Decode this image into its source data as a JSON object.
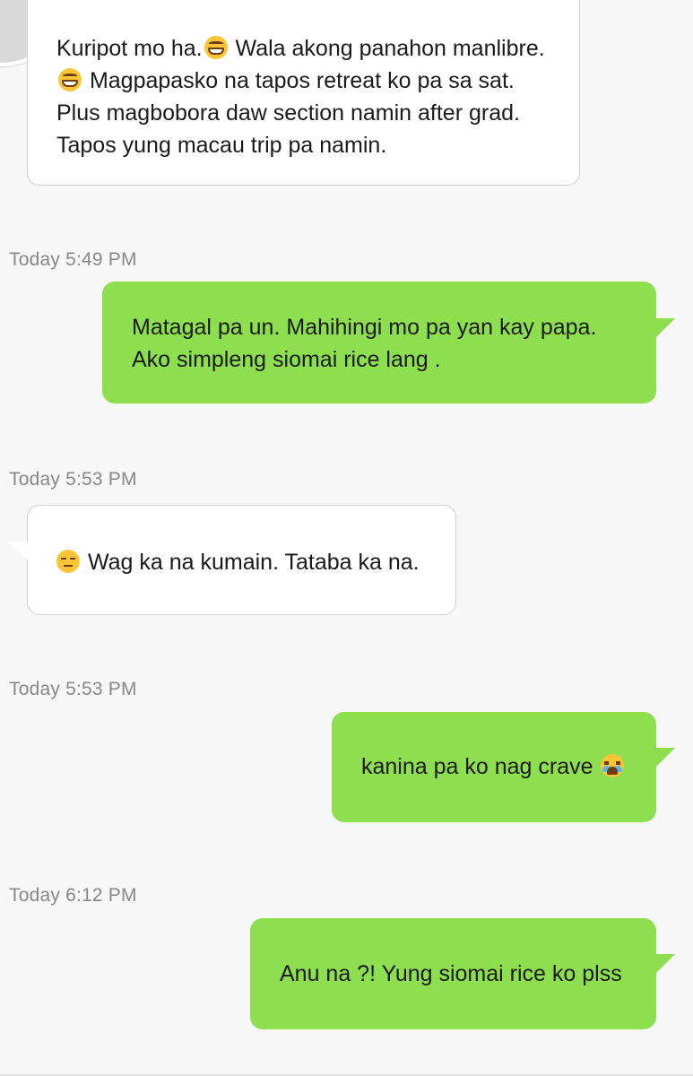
{
  "conversation": {
    "messages": [
      {
        "direction": "incoming",
        "segments": [
          "Kuripot mo ha.",
          " Wala akong panahon manlibre.",
          " Magpapasko na tapos retreat ko pa sa sat. Plus magbobora daw section namin after grad. Tapos yung macau trip pa namin."
        ],
        "emojis": [
          "grinning-face-emoji",
          "grinning-face-emoji"
        ]
      },
      {
        "direction": "outgoing",
        "timestamp": "Today 5:49 PM",
        "text": "Matagal pa un. Mahihingi mo pa yan kay papa. Ako simpleng siomai rice lang ."
      },
      {
        "direction": "incoming",
        "timestamp": "Today 5:53 PM",
        "text": "Wag ka na kumain. Tataba ka na.",
        "emoji": "expressionless-face-emoji"
      },
      {
        "direction": "outgoing",
        "timestamp": "Today 5:53 PM",
        "text": "kanina pa ko nag crave",
        "emoji": "crying-face-emoji"
      },
      {
        "direction": "outgoing",
        "timestamp": "Today 6:12 PM",
        "text": "Anu na ?! Yung siomai rice ko plss"
      }
    ]
  },
  "colors": {
    "background": "#f7f7f7",
    "outgoing_bubble": "#8ddf4f",
    "incoming_bubble": "#ffffff",
    "timestamp_text": "#888888"
  }
}
